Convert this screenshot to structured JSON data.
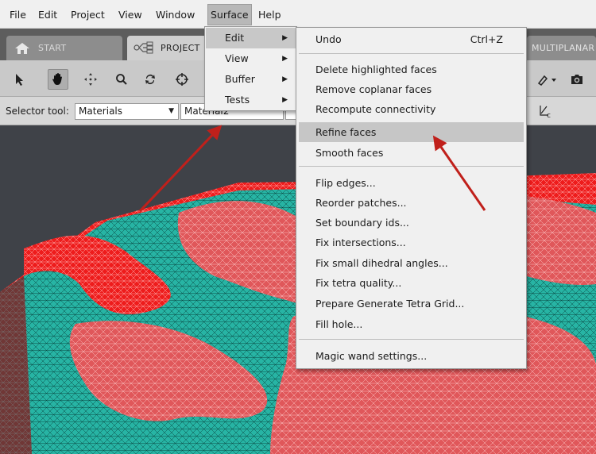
{
  "menubar": {
    "items": [
      "File",
      "Edit",
      "Project",
      "View",
      "Window",
      "Surface",
      "Help"
    ],
    "active": "Surface"
  },
  "tabs": {
    "start": "START",
    "project": "PROJECT",
    "multiplanar": "MULTIPLANAR"
  },
  "selector": {
    "label": "Selector tool:",
    "mode": "Materials",
    "material": "Material2"
  },
  "surface_menu": {
    "items": [
      "Edit",
      "View",
      "Buffer",
      "Tests"
    ],
    "highlighted": "Edit"
  },
  "edit_menu": {
    "undo": {
      "label": "Undo",
      "shortcut": "Ctrl+Z"
    },
    "delete_highlighted": "Delete highlighted faces",
    "remove_coplanar": "Remove coplanar faces",
    "recompute_connectivity": "Recompute connectivity",
    "refine_faces": "Refine faces",
    "smooth_faces": "Smooth faces",
    "flip_edges": "Flip edges...",
    "reorder_patches": "Reorder patches...",
    "set_boundary_ids": "Set boundary ids...",
    "fix_intersections": "Fix intersections...",
    "fix_dihedral": "Fix small dihedral angles...",
    "fix_tetra": "Fix tetra quality...",
    "prepare_tetra_grid": "Prepare Generate Tetra Grid...",
    "fill_hole": "Fill hole...",
    "magic_wand": "Magic wand settings..."
  },
  "colors": {
    "mesh_red": "#ee1c1c",
    "mesh_teal": "#27b4a4",
    "viewport_bg": "#3f4248",
    "annotation_arrow": "#c0201b",
    "menu_highlight": "#c6c6c6"
  },
  "icons": [
    "home-icon",
    "project-flow-icon",
    "select-arrow-icon",
    "pan-hand-icon",
    "move-icon",
    "zoom-icon",
    "rotate-icon",
    "target-icon",
    "paint-icon",
    "camera-icon",
    "selector-tool-icon"
  ]
}
